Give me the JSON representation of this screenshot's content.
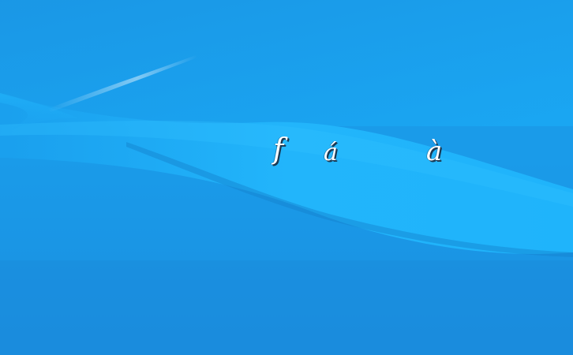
{
  "desktop": {
    "glyphs": [
      "f",
      "á",
      "à"
    ]
  },
  "colors": {
    "background_top": "#1a9ae8",
    "background_bottom": "#1b8fe0",
    "wave_light": "#22b4fb",
    "wave_mid": "#1fa6f2",
    "glyph_text": "#ffffff",
    "glyph_shadow": "#1a3a55"
  }
}
